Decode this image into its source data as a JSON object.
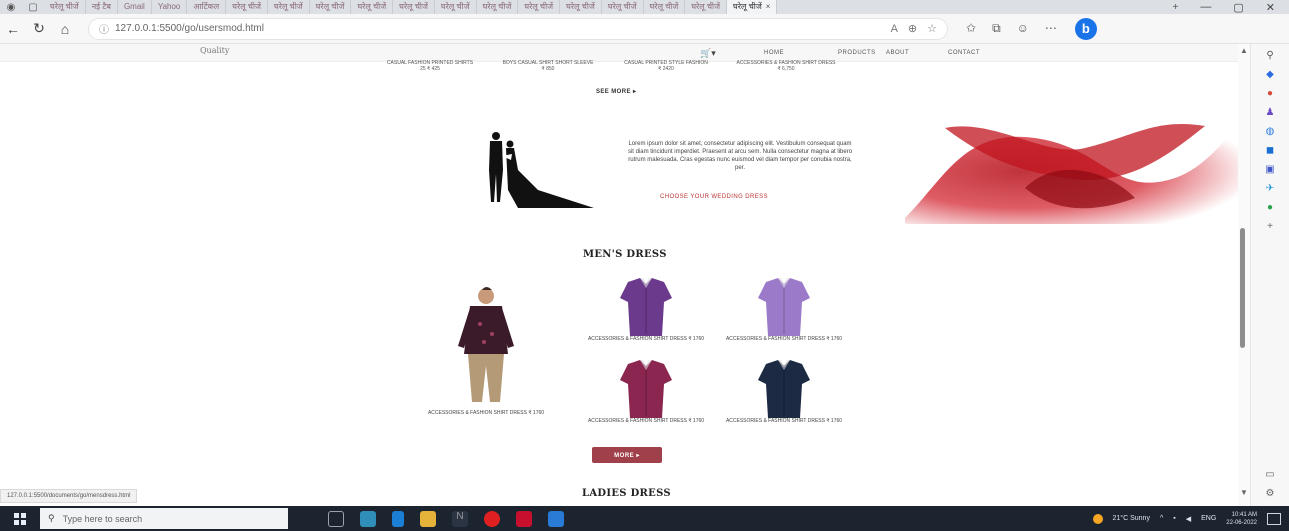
{
  "browser": {
    "tabs": [
      "घरेलू चीजें",
      "नई टैब",
      "Gmail",
      "Yahoo",
      "आर्टिकल",
      "घरेलू चीजें",
      "घरेलू चीजें",
      "घरेलू चीजें",
      "घरेलू चीजें",
      "घरेलू चीजें",
      "घरेलू चीजें",
      "घरेलू चीजें",
      "घरेलू चीजें",
      "घरेलू चीजें",
      "घरेलू चीजें",
      "घरेलू चीजें",
      "घरेलू चीजें",
      "घरेलू चीजें"
    ],
    "url": "127.0.0.1:5500/go/usersmod.html",
    "status_url": "127.0.0.1:5500/documents/go/mensdress.html"
  },
  "site": {
    "logo": "Quality",
    "nav": [
      "HOME",
      "PRODUCTS",
      "ABOUT",
      "CONTACT"
    ],
    "top_products": [
      {
        "name": "CASUAL FASHION PRINTED SHIRTS",
        "price": "25 ₹ 425"
      },
      {
        "name": "BOYS CASUAL SHIRT SHORT SLEEVE",
        "price": "₹ 850"
      },
      {
        "name": "CASUAL PRINTED STYLE FASHION",
        "price": "₹ 2420"
      },
      {
        "name": "ACCESSORIES & FASHION SHIRT DRESS",
        "price": "₹ 6,750"
      }
    ],
    "see_more": "SEE MORE ▸",
    "wedding": {
      "text": "Lorem ipsum dolor sit amet, consectetur adipiscing elit. Vestibulum consequat quam sit diam tincidunt imperdiet. Praesent at arcu sem. Nulla consectetur magna at libero rutrum malesuada. Cras egestas nunc euismod vel diam tempor per conubia nostra, per.",
      "link": "CHOOSE YOUR WEDDING DRESS"
    },
    "mens": {
      "title": "MEN'S DRESS",
      "model_caption": "ACCESSORIES & FASHION SHIRT DRESS  ₹ 1760",
      "items": [
        {
          "caption": "ACCESSORIES & FASHION SHIRT DRESS  ₹ 1760",
          "color": "#6b3a8c"
        },
        {
          "caption": "ACCESSORIES & FASHION SHIRT DRESS  ₹ 1760",
          "color": "#9b7bc9"
        },
        {
          "caption": "ACCESSORIES & FASHION SHIRT DRESS  ₹ 1760",
          "color": "#8a2650"
        },
        {
          "caption": "ACCESSORIES & FASHION SHIRT DRESS  ₹ 1760",
          "color": "#1d2a44"
        }
      ],
      "more": "MORE ▸"
    },
    "ladies": {
      "title": "LADIES DRESS"
    }
  },
  "taskbar": {
    "search_placeholder": "Type here to search",
    "weather": "21°C Sunny",
    "lang": "ENG",
    "time": "10:41 AM",
    "date": "22-06-2022"
  }
}
